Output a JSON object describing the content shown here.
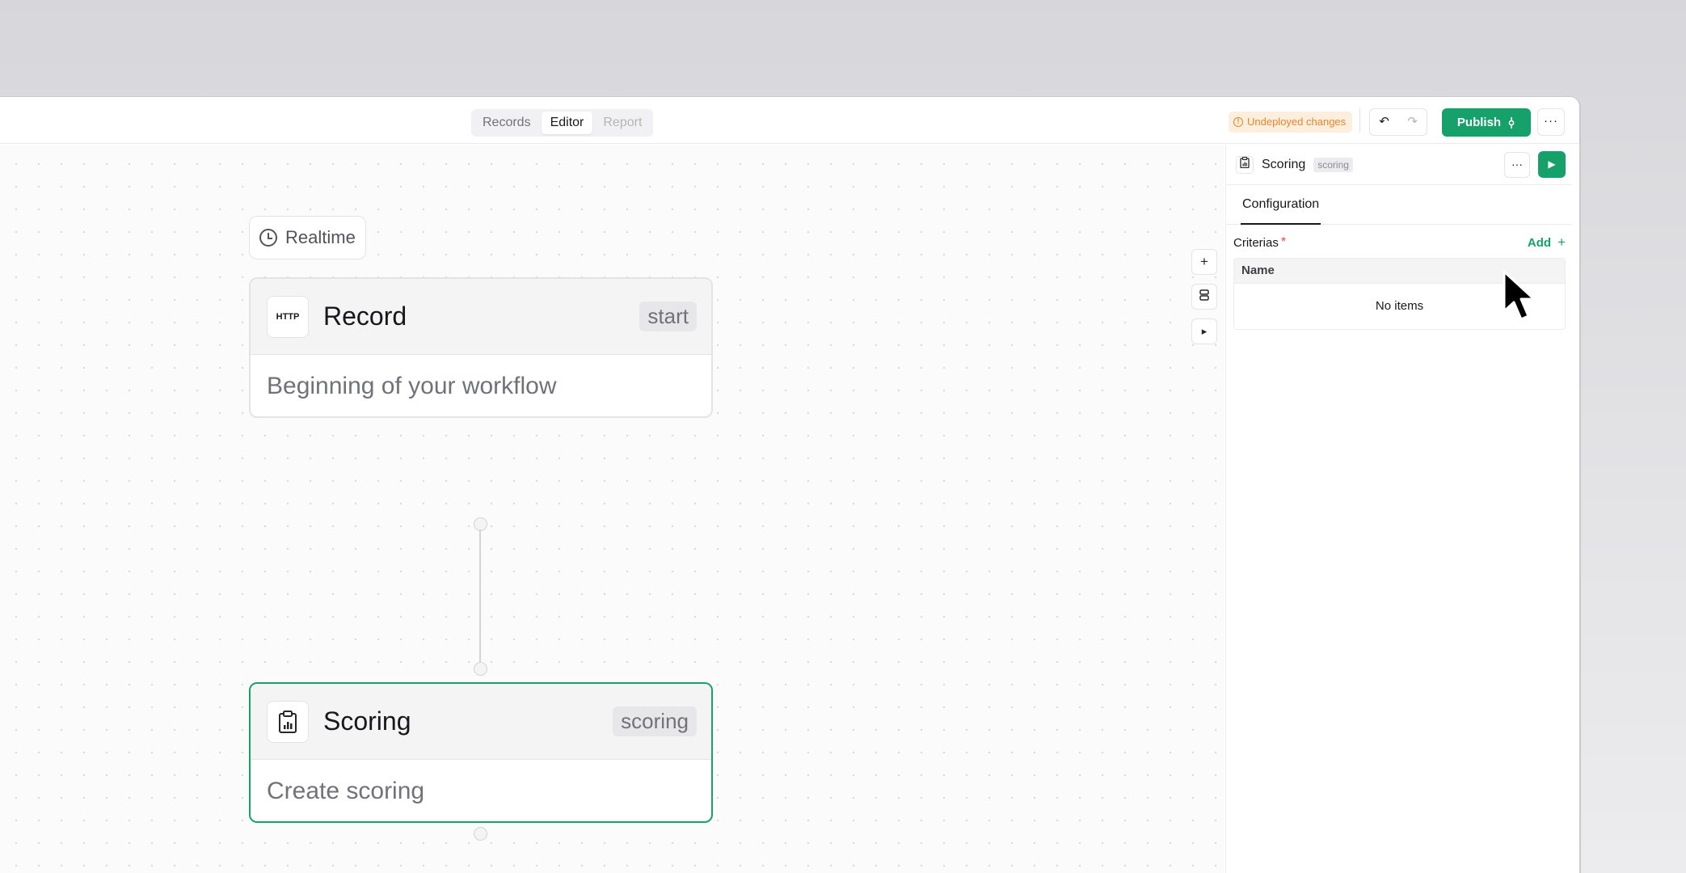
{
  "topbar": {
    "tabs": [
      {
        "label": "Records",
        "state": "normal"
      },
      {
        "label": "Editor",
        "state": "active"
      },
      {
        "label": "Report",
        "state": "disabled"
      }
    ],
    "warning_label": "Undeployed changes",
    "undo_icon": "↶",
    "redo_icon": "↷",
    "publish_label": "Publish",
    "more_icon": "···"
  },
  "canvas": {
    "tools": [
      {
        "name": "add-node-button",
        "icon": "+"
      },
      {
        "name": "layers-button",
        "icon": "≣"
      },
      {
        "name": "run-button",
        "icon": "▸"
      }
    ],
    "trigger": {
      "label": "Realtime"
    },
    "nodes": [
      {
        "icon_text": "HTTP",
        "title": "Record",
        "tag": "start",
        "description": "Beginning of your workflow"
      },
      {
        "icon_text": "",
        "title": "Scoring",
        "tag": "scoring",
        "description": "Create scoring",
        "selected": true
      }
    ]
  },
  "panel": {
    "title": "Scoring",
    "tag": "scoring",
    "more_icon": "···",
    "run_icon": "▶",
    "tab_label": "Configuration",
    "criteria_label": "Criterias",
    "required_mark": "*",
    "add_label": "Add",
    "add_icon": "+",
    "table_header": "Name",
    "empty_text": "No items"
  },
  "colors": {
    "accent": "#16a06a",
    "warning_bg": "#fdeedd",
    "warning_fg": "#e7862b"
  }
}
